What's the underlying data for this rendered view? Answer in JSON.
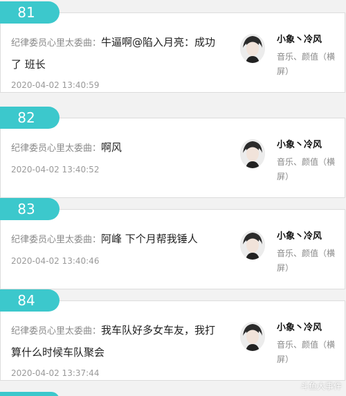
{
  "entries": [
    {
      "rank": "81",
      "sender": "纪律委员心里太委曲：",
      "message": "牛逼啊@陷入月亮：成功了 班长",
      "time": "2020-04-02 13:40:59",
      "song_title": "小象丶冷风",
      "song_tags": "音乐、颜值（横屏）"
    },
    {
      "rank": "82",
      "sender": "纪律委员心里太委曲：",
      "message": "啊风",
      "time": "2020-04-02 13:40:52",
      "song_title": "小象丶冷风",
      "song_tags": "音乐、颜值（横屏）"
    },
    {
      "rank": "83",
      "sender": "纪律委员心里太委曲：",
      "message": "阿峰 下个月帮我锤人",
      "time": "2020-04-02 13:40:46",
      "song_title": "小象丶冷风",
      "song_tags": "音乐、颜值（横屏）"
    },
    {
      "rank": "84",
      "sender": "纪律委员心里太委曲：",
      "message": "我车队好多女车友，我打算什么时候车队聚会",
      "time": "2020-04-02 13:37:44",
      "song_title": "小象丶冷风",
      "song_tags": "音乐、颜值（横屏）"
    }
  ],
  "watermark": "斗鱼大事件",
  "colors": {
    "accent": "#3cc8cc"
  }
}
